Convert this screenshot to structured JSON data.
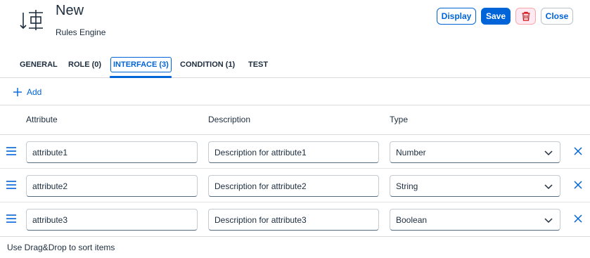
{
  "header": {
    "title": "New",
    "subtitle": "Rules Engine",
    "icon": "rules-engine-icon"
  },
  "actions": {
    "display_label": "Display",
    "save_label": "Save",
    "delete_icon": "trash-icon",
    "close_label": "Close"
  },
  "tabs": [
    {
      "label": "GENERAL",
      "active": false
    },
    {
      "label": "ROLE (0)",
      "active": false
    },
    {
      "label": "INTERFACE (3)",
      "active": true
    },
    {
      "label": "CONDITION (1)",
      "active": false
    },
    {
      "label": "TEST",
      "active": false
    }
  ],
  "toolbar": {
    "add_label": "Add",
    "add_icon": "plus-icon"
  },
  "table": {
    "columns": [
      "Attribute",
      "Description",
      "Type"
    ],
    "rows": [
      {
        "attribute": "attribute1",
        "description": "Description for attribute1",
        "type": "Number"
      },
      {
        "attribute": "attribute2",
        "description": "Description for attribute2",
        "type": "String"
      },
      {
        "attribute": "attribute3",
        "description": "Description for attribute3",
        "type": "Boolean"
      }
    ]
  },
  "footer": {
    "hint": "Use Drag&Drop to sort items"
  },
  "colors": {
    "accent": "#0064d9",
    "danger": "#d20a0a",
    "text": "#1d2d3e"
  }
}
